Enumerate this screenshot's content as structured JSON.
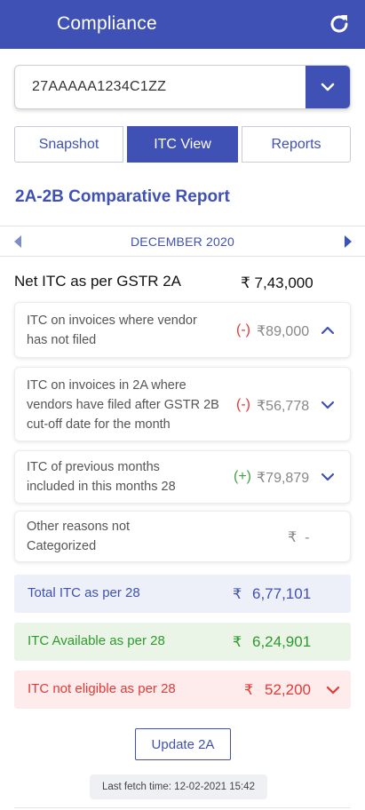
{
  "header": {
    "title": "Compliance",
    "refresh_icon": "refresh-icon",
    "color": "#3f51b5"
  },
  "gstin_select": {
    "value": "27AAAAA1234C1ZZ",
    "dropdown_icon": "chevron-down-icon"
  },
  "tabs": [
    {
      "label": "Snapshot",
      "active": false
    },
    {
      "label": "ITC View",
      "active": true
    },
    {
      "label": "Reports",
      "active": false
    }
  ],
  "report": {
    "title": "2A-2B Comparative Report",
    "month": "DECEMBER 2020",
    "prev_icon": "caret-left-icon",
    "next_icon": "caret-right-icon"
  },
  "net_itc": {
    "label": "Net ITC as per GSTR 2A",
    "amount": "₹ 7,43,000"
  },
  "adjustments": [
    {
      "text_line1": "ITC on invoices where vendor",
      "text_line2": "has not filed",
      "text_line3": "",
      "sign": "(-)",
      "amount": "₹89,000",
      "expanded": true
    },
    {
      "text_line1": "ITC on invoices in 2A where",
      "text_line2": "vendors have filed after GSTR 2B",
      "text_line3": "cut-off date for the month",
      "sign": "(-)",
      "amount": "₹56,778",
      "expanded": false
    },
    {
      "text_line1": "ITC of previous months",
      "text_line2": "included in this months 28",
      "text_line3": "",
      "sign": "(+)",
      "amount": "₹79,879",
      "expanded": false
    },
    {
      "text_line1": "Other reasons not",
      "text_line2": "Categorized",
      "text_line3": "",
      "sign": "",
      "amount": "₹  -",
      "expanded": false
    }
  ],
  "summary": {
    "total": {
      "label": "Total ITC as per 28",
      "currency": "₹",
      "value": "6,77,101"
    },
    "available": {
      "label": "ITC Available as per 28",
      "currency": "₹",
      "value": "6,24,901"
    },
    "not_eligible": {
      "label": "ITC not eligible as per 28",
      "currency": "₹",
      "value": "52,200"
    }
  },
  "actions": {
    "update_label": "Update 2A",
    "last_fetch": "Last fetch time: 12-02-2021 15:42"
  },
  "colors": {
    "primary": "#3f51b5",
    "negative": "#e53935",
    "positive": "#43a047"
  }
}
